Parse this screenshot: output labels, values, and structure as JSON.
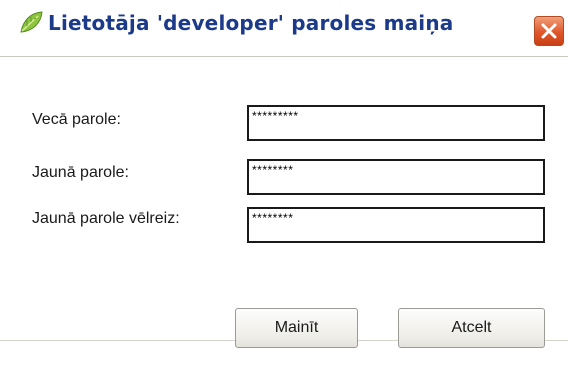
{
  "window": {
    "title": "Lietotāja 'developer' paroles maiņa",
    "icon": "leaf-icon",
    "close_icon": "close-icon"
  },
  "form": {
    "fields": [
      {
        "label": "Vecā parole:",
        "value": "*********"
      },
      {
        "label": "Jaunā parole:",
        "value": "********"
      },
      {
        "label": "Jaunā parole vēlreiz:",
        "value": "********"
      }
    ]
  },
  "buttons": {
    "change": "Mainīt",
    "cancel": "Atcelt"
  },
  "colors": {
    "title_text": "#1c3a8a",
    "close_button": "#e0572c"
  }
}
